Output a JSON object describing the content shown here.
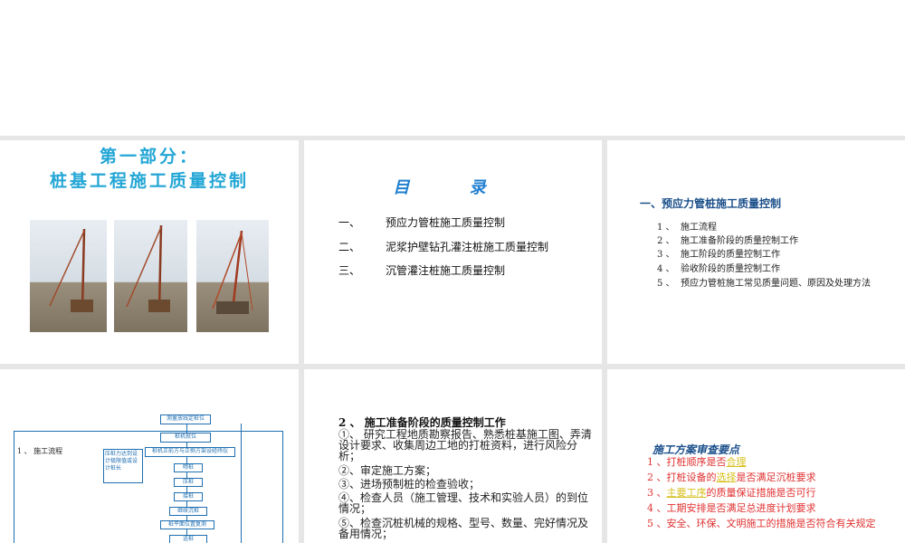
{
  "slide1": {
    "title_line1": "第一部分：",
    "title_line2": "桩基工程施工质量控制"
  },
  "slide2": {
    "title": "目 录",
    "items": [
      {
        "num": "一、",
        "text": "预应力管桩施工质量控制"
      },
      {
        "num": "二、",
        "text": "泥浆护壁钻孔灌注桩施工质量控制"
      },
      {
        "num": "三、",
        "text": "沉管灌注桩施工质量控制"
      }
    ]
  },
  "slide3": {
    "heading": "一、预应力管桩施工质量控制",
    "items": [
      {
        "num": "1 、",
        "text": "施工流程"
      },
      {
        "num": "2 、",
        "text": "施工准备阶段的质量控制工作"
      },
      {
        "num": "3 、",
        "text": "施工阶段的质量控制工作"
      },
      {
        "num": "4 、",
        "text": "验收阶段的质量控制工作"
      },
      {
        "num": "5 、",
        "text": "预应力管桩施工常见质量问题、原因及处理方法"
      }
    ]
  },
  "slide4": {
    "label": "1 、 施工流程",
    "boxes": {
      "b1": "测量放线定桩位",
      "b2": "桩机就位",
      "b3": "桩机正前方与正侧方架设经纬仪",
      "b4": "喂桩",
      "b5": "压桩",
      "b6": "接桩",
      "b7": "继续沉桩",
      "b8": "桩平面位置复测",
      "b9": "送桩",
      "side": "压桩力达到设计极限值或设计桩长"
    }
  },
  "slide5": {
    "title": "2 、 施工准备阶段的质量控制工作",
    "items": [
      "①、 研究工程地质勘察报告、熟悉桩基施工图、弄清设计要求、收集周边工地的打桩资料，进行风险分析；",
      "②、审定施工方案；",
      "③、进场预制桩的检查验收；",
      "④、检查人员（施工管理、技术和实验人员）的到位情况；",
      "⑤、检查沉桩机械的规格、型号、数量、完好情况及备用情况；"
    ]
  },
  "slide6": {
    "title": "施工方案审查要点",
    "items": [
      {
        "pre": "1 、打桩顺序是否",
        "hl": "合理",
        "post": ""
      },
      {
        "pre": "2 、打桩设备的",
        "hl": "选择",
        "post": "是否满足沉桩要求"
      },
      {
        "pre": "3 、",
        "hl": "主要工序",
        "post": "的质量保证措施是否可行"
      },
      {
        "pre": "4 、工期安排是否满足总进度计划要求",
        "hl": "",
        "post": ""
      },
      {
        "pre": "5 、安全、环保、文明施工的措施是否符合有关规定",
        "hl": "",
        "post": ""
      }
    ],
    "highlight_color": "#d8c020",
    "text_color": "#e03030"
  }
}
